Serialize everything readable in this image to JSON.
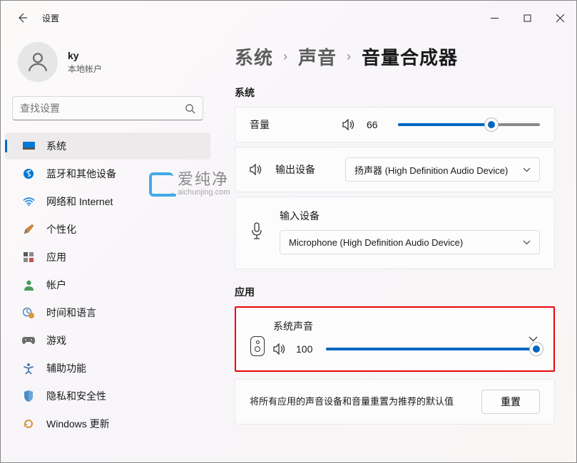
{
  "window": {
    "title": "设置"
  },
  "profile": {
    "username": "ky",
    "account_type": "本地帐户"
  },
  "search": {
    "placeholder": "查找设置"
  },
  "nav": {
    "items": [
      {
        "label": "系统",
        "active": true
      },
      {
        "label": "蓝牙和其他设备"
      },
      {
        "label": "网络和 Internet"
      },
      {
        "label": "个性化"
      },
      {
        "label": "应用"
      },
      {
        "label": "帐户"
      },
      {
        "label": "时间和语言"
      },
      {
        "label": "游戏"
      },
      {
        "label": "辅助功能"
      },
      {
        "label": "隐私和安全性"
      },
      {
        "label": "Windows 更新"
      }
    ]
  },
  "breadcrumb": {
    "level1": "系统",
    "level2": "声音",
    "level3": "音量合成器"
  },
  "sections": {
    "system": "系统",
    "apps": "应用"
  },
  "volume": {
    "label": "音量",
    "value": 66
  },
  "output": {
    "label": "输出设备",
    "selected": "扬声器 (High Definition Audio Device)"
  },
  "input": {
    "label": "输入设备",
    "selected": "Microphone (High Definition Audio Device)"
  },
  "app_sound": {
    "title": "系统声音",
    "value": 100
  },
  "reset": {
    "description": "将所有应用的声音设备和音量重置为推荐的默认值",
    "button": "重置"
  },
  "watermark": {
    "main": "爱纯净",
    "sub": "aichunjing.com"
  }
}
